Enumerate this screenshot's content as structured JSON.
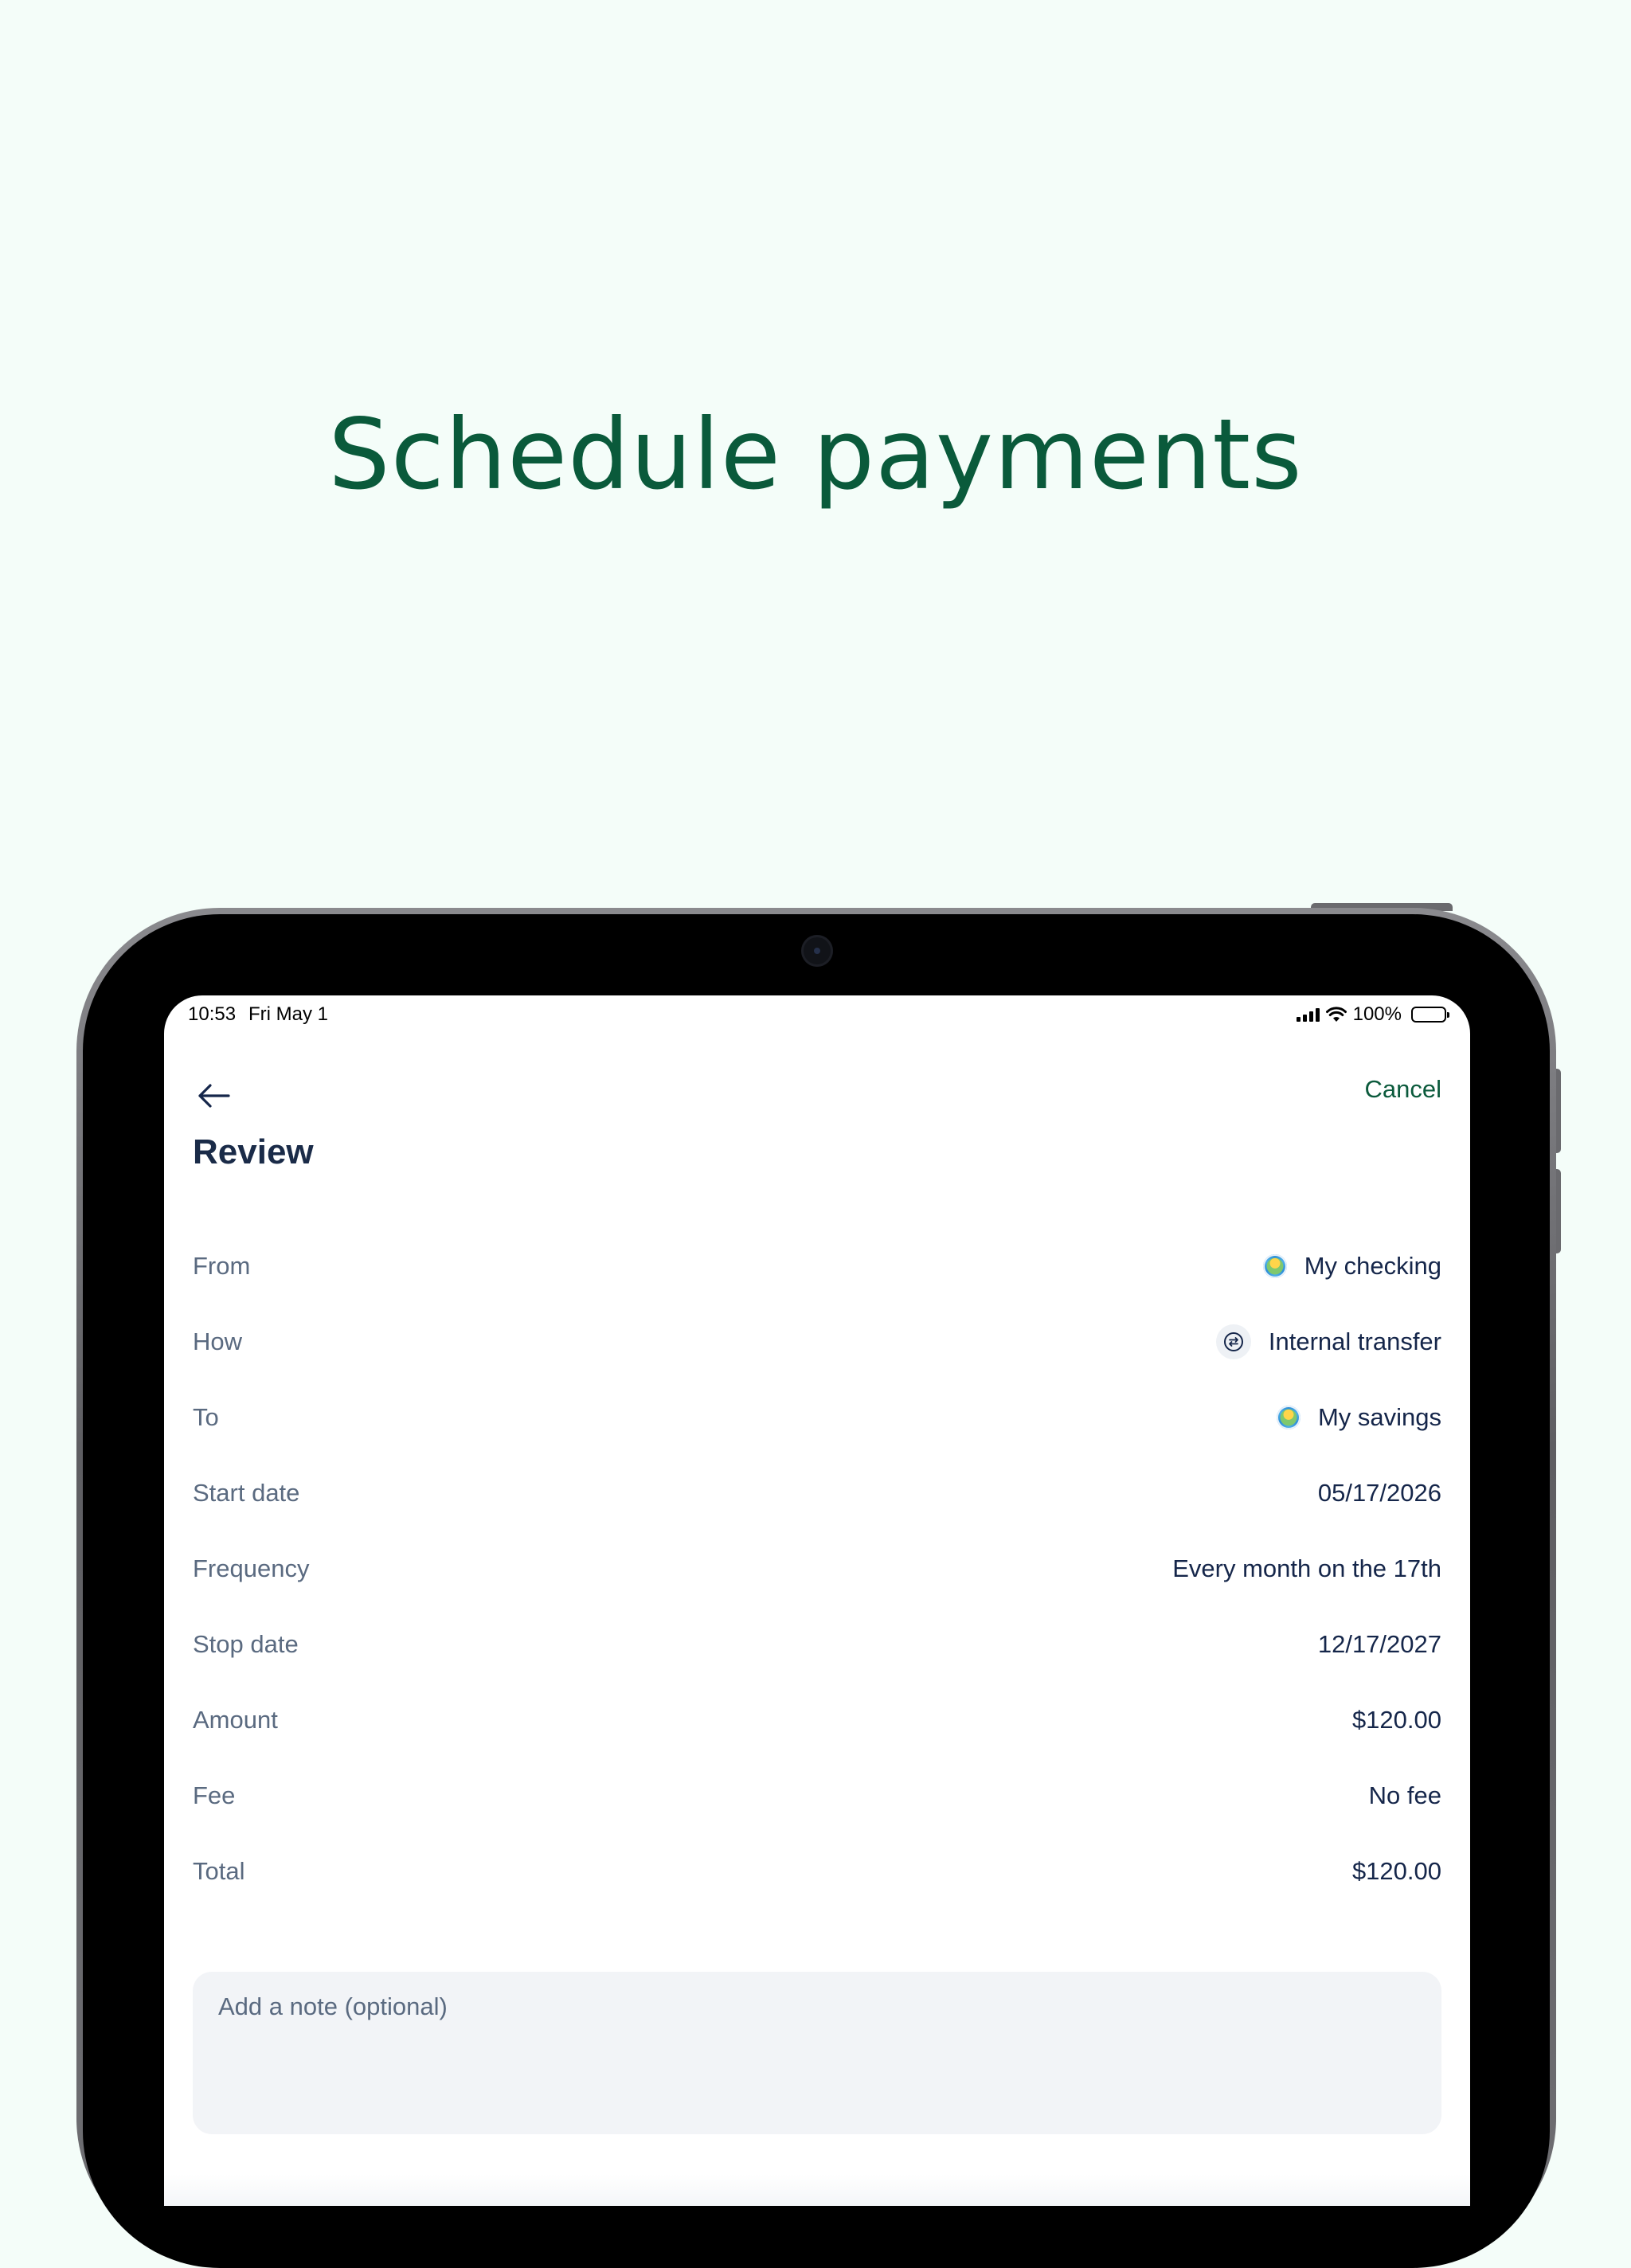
{
  "headline": "Schedule payments",
  "status_bar": {
    "time": "10:53",
    "date": "Fri May 1",
    "battery_percent": "100%"
  },
  "nav": {
    "cancel_label": "Cancel",
    "back_icon": "arrow-left-icon"
  },
  "page": {
    "title": "Review"
  },
  "review_rows": [
    {
      "label": "From",
      "value": "My checking",
      "icon": "bank-logo-icon"
    },
    {
      "label": "How",
      "value": "Internal transfer",
      "icon": "transfer-icon"
    },
    {
      "label": "To",
      "value": "My savings",
      "icon": "bank-logo-icon"
    },
    {
      "label": "Start date",
      "value": "05/17/2026"
    },
    {
      "label": "Frequency",
      "value": "Every month on the 17th"
    },
    {
      "label": "Stop date",
      "value": "12/17/2027"
    },
    {
      "label": "Amount",
      "value": "$120.00"
    },
    {
      "label": "Fee",
      "value": "No fee"
    },
    {
      "label": "Total",
      "value": "$120.00"
    }
  ],
  "note": {
    "placeholder": "Add a note (optional)"
  },
  "colors": {
    "background": "#f4fdf9",
    "brand_green": "#0a5a3b",
    "navy_text": "#15264a",
    "muted_label": "#5a6a80"
  }
}
